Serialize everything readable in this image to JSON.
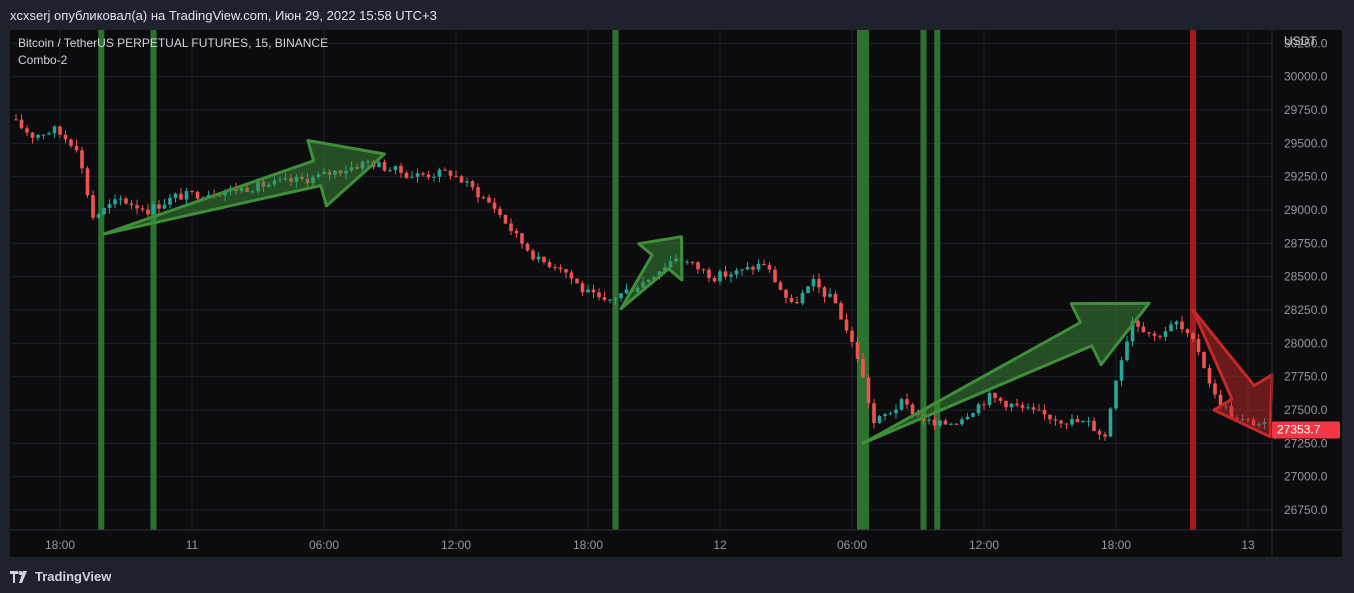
{
  "header": {
    "publish_line": "xcxserj опубликовал(а) на TradingView.com, Июн 29, 2022 15:58 UTC+3"
  },
  "legend": {
    "symbol": "Bitcoin / TetherUS PERPETUAL FUTURES, 15, BINANCE",
    "indicator": "Combo-2"
  },
  "price_scale": {
    "currency": "USDT",
    "last_price": "27353.7"
  },
  "footer": {
    "brand": "TradingView"
  },
  "colors": {
    "background": "#0c0c0f",
    "frame": "#1e222d",
    "up": "#26a69a",
    "down": "#ef5350",
    "grid": "#1d2129",
    "signal_buy": "#2e7d32",
    "signal_sell": "#b71c1c",
    "arrow_green": "#3f8f3a",
    "arrow_red": "#c62828",
    "price_label": "#f23645"
  },
  "chart_data": {
    "type": "candlestick",
    "title": "Bitcoin / TetherUS PERPETUAL FUTURES, 15, BINANCE",
    "subtitle": "Combo-2",
    "interval": "15",
    "exchange": "BINANCE",
    "ylabel": "USDT",
    "ylim": [
      26600,
      30350
    ],
    "y_ticks": [
      "30250.0",
      "30000.0",
      "29750.0",
      "29500.0",
      "29250.0",
      "29000.0",
      "28750.0",
      "28500.0",
      "28250.0",
      "28000.0",
      "27750.0",
      "27500.0",
      "27250.0",
      "27000.0",
      "26750.0"
    ],
    "x_ticks": [
      {
        "label": "18:00",
        "bar": 8
      },
      {
        "label": "11",
        "bar": 32
      },
      {
        "label": "06:00",
        "bar": 56
      },
      {
        "label": "12:00",
        "bar": 80
      },
      {
        "label": "18:00",
        "bar": 104
      },
      {
        "label": "12",
        "bar": 128
      },
      {
        "label": "06:00",
        "bar": 152
      },
      {
        "label": "12:00",
        "bar": 176
      },
      {
        "label": "18:00",
        "bar": 200
      },
      {
        "label": "13",
        "bar": 224
      }
    ],
    "last_price": 27353.7,
    "waypoints": [
      {
        "bar": 0,
        "price": 29680
      },
      {
        "bar": 4,
        "price": 29560
      },
      {
        "bar": 8,
        "price": 29600
      },
      {
        "bar": 12,
        "price": 29480
      },
      {
        "bar": 15,
        "price": 28950
      },
      {
        "bar": 20,
        "price": 29080
      },
      {
        "bar": 25,
        "price": 29000
      },
      {
        "bar": 30,
        "price": 29100
      },
      {
        "bar": 40,
        "price": 29150
      },
      {
        "bar": 55,
        "price": 29240
      },
      {
        "bar": 65,
        "price": 29360
      },
      {
        "bar": 73,
        "price": 29260
      },
      {
        "bar": 80,
        "price": 29280
      },
      {
        "bar": 84,
        "price": 29160
      },
      {
        "bar": 88,
        "price": 29020
      },
      {
        "bar": 92,
        "price": 28800
      },
      {
        "bar": 96,
        "price": 28620
      },
      {
        "bar": 100,
        "price": 28580
      },
      {
        "bar": 104,
        "price": 28400
      },
      {
        "bar": 108,
        "price": 28300
      },
      {
        "bar": 110,
        "price": 28350
      },
      {
        "bar": 115,
        "price": 28460
      },
      {
        "bar": 121,
        "price": 28650
      },
      {
        "bar": 128,
        "price": 28500
      },
      {
        "bar": 133,
        "price": 28540
      },
      {
        "bar": 137,
        "price": 28600
      },
      {
        "bar": 142,
        "price": 28280
      },
      {
        "bar": 146,
        "price": 28450
      },
      {
        "bar": 150,
        "price": 28300
      },
      {
        "bar": 154,
        "price": 27900
      },
      {
        "bar": 157,
        "price": 27400
      },
      {
        "bar": 162,
        "price": 27550
      },
      {
        "bar": 168,
        "price": 27380
      },
      {
        "bar": 172,
        "price": 27420
      },
      {
        "bar": 178,
        "price": 27600
      },
      {
        "bar": 186,
        "price": 27480
      },
      {
        "bar": 192,
        "price": 27420
      },
      {
        "bar": 196,
        "price": 27400
      },
      {
        "bar": 199,
        "price": 27300
      },
      {
        "bar": 201,
        "price": 27750
      },
      {
        "bar": 204,
        "price": 28180
      },
      {
        "bar": 208,
        "price": 28050
      },
      {
        "bar": 212,
        "price": 28150
      },
      {
        "bar": 216,
        "price": 27950
      },
      {
        "bar": 219,
        "price": 27600
      },
      {
        "bar": 223,
        "price": 27420
      },
      {
        "bar": 227,
        "price": 27400
      },
      {
        "bar": 230,
        "price": 27350
      }
    ],
    "signals": [
      {
        "type": "buy",
        "bar": 15.5,
        "width_bars": 1
      },
      {
        "type": "buy",
        "bar": 25,
        "width_bars": 1
      },
      {
        "type": "buy",
        "bar": 109,
        "width_bars": 1
      },
      {
        "type": "buy",
        "bar": 154,
        "width_bars": 2
      },
      {
        "type": "buy",
        "bar": 165,
        "width_bars": 1
      },
      {
        "type": "buy",
        "bar": 167.5,
        "width_bars": 1
      },
      {
        "type": "sell",
        "bar": 214,
        "width_bars": 1
      }
    ],
    "trend_arrows": [
      {
        "direction": "up",
        "from": {
          "bar": 16,
          "price": 28820
        },
        "to": {
          "bar": 67,
          "price": 29420
        }
      },
      {
        "direction": "up",
        "from": {
          "bar": 110,
          "price": 28260
        },
        "to": {
          "bar": 121,
          "price": 28800
        }
      },
      {
        "direction": "up",
        "from": {
          "bar": 154,
          "price": 27250
        },
        "to": {
          "bar": 206,
          "price": 28300
        }
      },
      {
        "direction": "down",
        "from": {
          "bar": 214,
          "price": 28250
        },
        "to": {
          "bar": 228,
          "price": 27300
        }
      }
    ]
  }
}
